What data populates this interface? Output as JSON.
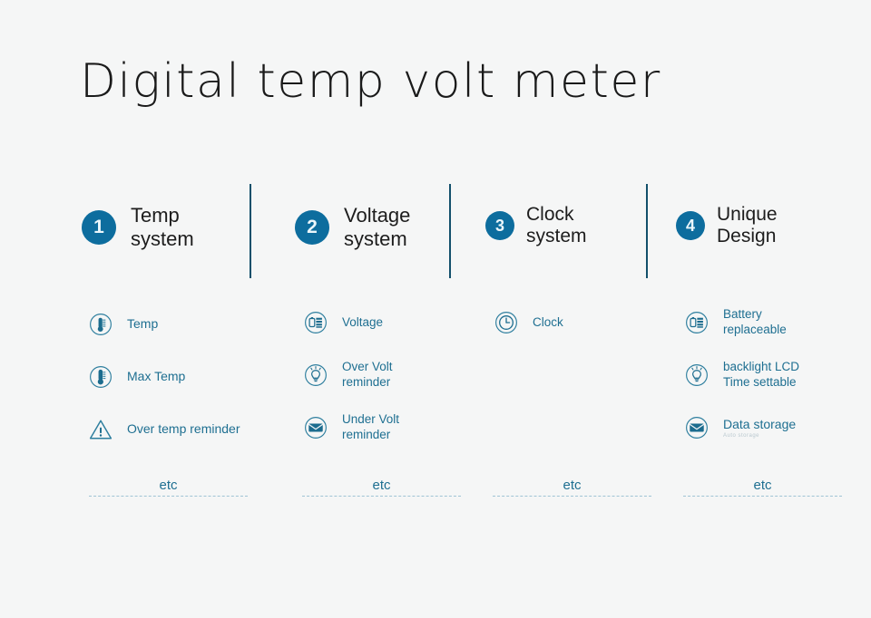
{
  "page": {
    "title": "Digital temp volt meter",
    "background_color": "#f5f6f6",
    "accent_color": "#0d6d9e",
    "feature_text_color": "#1e6f91",
    "divider_color": "#13506b"
  },
  "columns": [
    {
      "number": "1",
      "heading": "Temp\nsystem",
      "etc_label": "etc",
      "features": [
        {
          "icon": "thermometer-icon",
          "label": "Temp"
        },
        {
          "icon": "thermometer-icon",
          "label": "Max Temp"
        },
        {
          "icon": "warning-triangle-icon",
          "label": "Over temp reminder"
        }
      ]
    },
    {
      "number": "2",
      "heading": "Voltage\nsystem",
      "etc_label": "etc",
      "features": [
        {
          "icon": "battery-meter-icon",
          "label": "Voltage"
        },
        {
          "icon": "lightbulb-icon",
          "label": "Over Volt\nreminder"
        },
        {
          "icon": "envelope-icon",
          "label": "Under Volt\nreminder"
        }
      ]
    },
    {
      "number": "3",
      "heading": "Clock\nsystem",
      "etc_label": "etc",
      "features": [
        {
          "icon": "clock-icon",
          "label": "Clock"
        }
      ]
    },
    {
      "number": "4",
      "heading": "Unique\nDesign",
      "etc_label": "etc",
      "features": [
        {
          "icon": "battery-meter-icon",
          "label": "Battery\nreplaceable"
        },
        {
          "icon": "lightbulb-icon",
          "label": "backlight LCD\nTime settable"
        },
        {
          "icon": "envelope-icon",
          "label": "Data storage",
          "sublabel": "Auto  storage"
        }
      ]
    }
  ]
}
